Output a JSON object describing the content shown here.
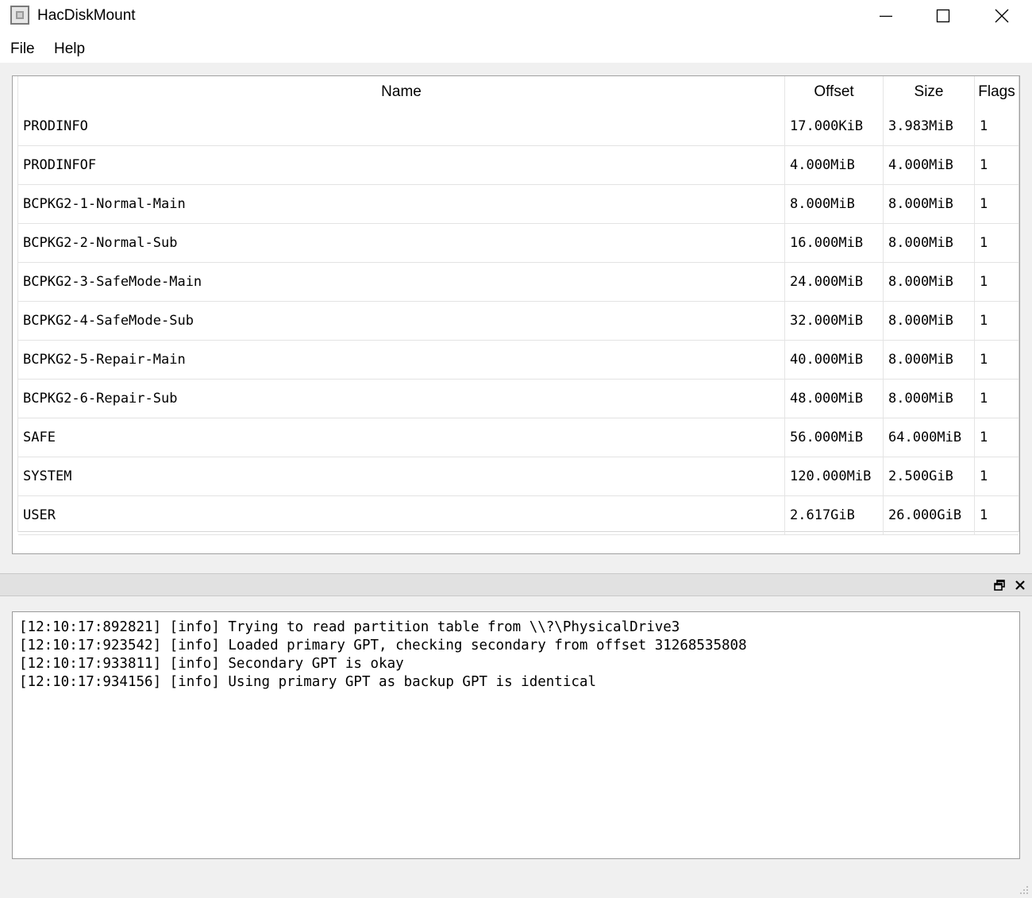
{
  "window": {
    "title": "HacDiskMount"
  },
  "menu": {
    "file": "File",
    "help": "Help"
  },
  "table": {
    "headers": {
      "name": "Name",
      "offset": "Offset",
      "size": "Size",
      "flags": "Flags"
    },
    "rows": [
      {
        "name": "PRODINFO",
        "offset": "17.000KiB",
        "size": "3.983MiB",
        "flags": "1"
      },
      {
        "name": "PRODINFOF",
        "offset": "4.000MiB",
        "size": "4.000MiB",
        "flags": "1"
      },
      {
        "name": "BCPKG2-1-Normal-Main",
        "offset": "8.000MiB",
        "size": "8.000MiB",
        "flags": "1"
      },
      {
        "name": "BCPKG2-2-Normal-Sub",
        "offset": "16.000MiB",
        "size": "8.000MiB",
        "flags": "1"
      },
      {
        "name": "BCPKG2-3-SafeMode-Main",
        "offset": "24.000MiB",
        "size": "8.000MiB",
        "flags": "1"
      },
      {
        "name": "BCPKG2-4-SafeMode-Sub",
        "offset": "32.000MiB",
        "size": "8.000MiB",
        "flags": "1"
      },
      {
        "name": "BCPKG2-5-Repair-Main",
        "offset": "40.000MiB",
        "size": "8.000MiB",
        "flags": "1"
      },
      {
        "name": "BCPKG2-6-Repair-Sub",
        "offset": "48.000MiB",
        "size": "8.000MiB",
        "flags": "1"
      },
      {
        "name": "SAFE",
        "offset": "56.000MiB",
        "size": "64.000MiB",
        "flags": "1"
      },
      {
        "name": "SYSTEM",
        "offset": "120.000MiB",
        "size": "2.500GiB",
        "flags": "1"
      },
      {
        "name": "USER",
        "offset": "2.617GiB",
        "size": "26.000GiB",
        "flags": "1"
      }
    ]
  },
  "log": {
    "lines": [
      "[12:10:17:892821] [info] Trying to read partition table from \\\\?\\PhysicalDrive3",
      "[12:10:17:923542] [info] Loaded primary GPT, checking secondary from offset 31268535808",
      "[12:10:17:933811] [info] Secondary GPT is okay",
      "[12:10:17:934156] [info] Using primary GPT as backup GPT is identical"
    ]
  },
  "icons": {
    "app": "app-icon",
    "minimize": "minimize-icon",
    "maximize": "maximize-icon",
    "close": "close-icon",
    "float": "float-icon",
    "dock_close": "close-icon",
    "grip": "resize-grip-icon"
  }
}
